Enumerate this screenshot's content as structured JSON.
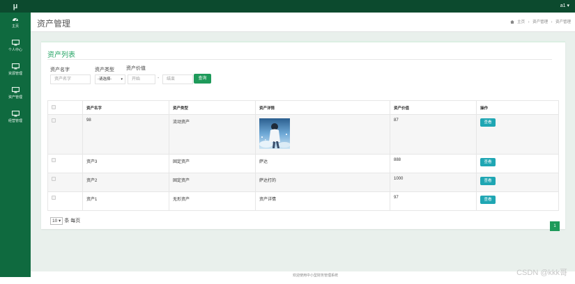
{
  "app": {
    "logo": "μ",
    "user_menu": "a1 ▾"
  },
  "sidebar": {
    "items": [
      {
        "label": "主页",
        "icon": "dashboard-icon"
      },
      {
        "label": "个人中心",
        "icon": "monitor-icon"
      },
      {
        "label": "资源管理",
        "icon": "monitor-icon"
      },
      {
        "label": "资产管理",
        "icon": "monitor-icon"
      },
      {
        "label": "经营管理",
        "icon": "monitor-icon"
      }
    ]
  },
  "header": {
    "title": "资产管理",
    "breadcrumb": {
      "home_icon": "home-icon",
      "home": "主页",
      "sep": "›",
      "level1": "资产管理",
      "level2": "资产管理"
    }
  },
  "panel": {
    "title": "资产列表"
  },
  "filters": {
    "name_label": "资产名字",
    "name_placeholder": "资产名字",
    "type_label": "资产类型",
    "type_selected": "-请选择-",
    "value_label": "资产价值",
    "start_placeholder": "开始",
    "range_dash": "-",
    "end_placeholder": "结束",
    "search_button": "查询"
  },
  "table": {
    "headers": [
      "资产名字",
      "资产类型",
      "资产详情",
      "资产价值",
      "操作"
    ],
    "rows": [
      {
        "name": "98",
        "type": "流动资产",
        "detail": "",
        "has_image": true,
        "value": "87",
        "action": "查看"
      },
      {
        "name": "资产3",
        "type": "固定资产",
        "detail": "萨达",
        "has_image": false,
        "value": "888",
        "action": "查看"
      },
      {
        "name": "资产2",
        "type": "固定资产",
        "detail": "萨达打的",
        "has_image": false,
        "value": "1000",
        "action": "查看"
      },
      {
        "name": "资产1",
        "type": "无形资产",
        "detail": "资产详情",
        "has_image": false,
        "value": "97",
        "action": "查看"
      }
    ]
  },
  "pagination": {
    "page_size": "10",
    "page_size_suffix": "条 每页",
    "current_page": "1"
  },
  "footer": {
    "text": "欢迎使用中小型财务管理系统"
  },
  "watermark": "CSDN @kkk哥",
  "colors": {
    "topbar": "#0c4a2e",
    "sidebar": "#0f6a3f",
    "accent_green": "#1e9a5a",
    "view_button": "#1fa6b3"
  }
}
